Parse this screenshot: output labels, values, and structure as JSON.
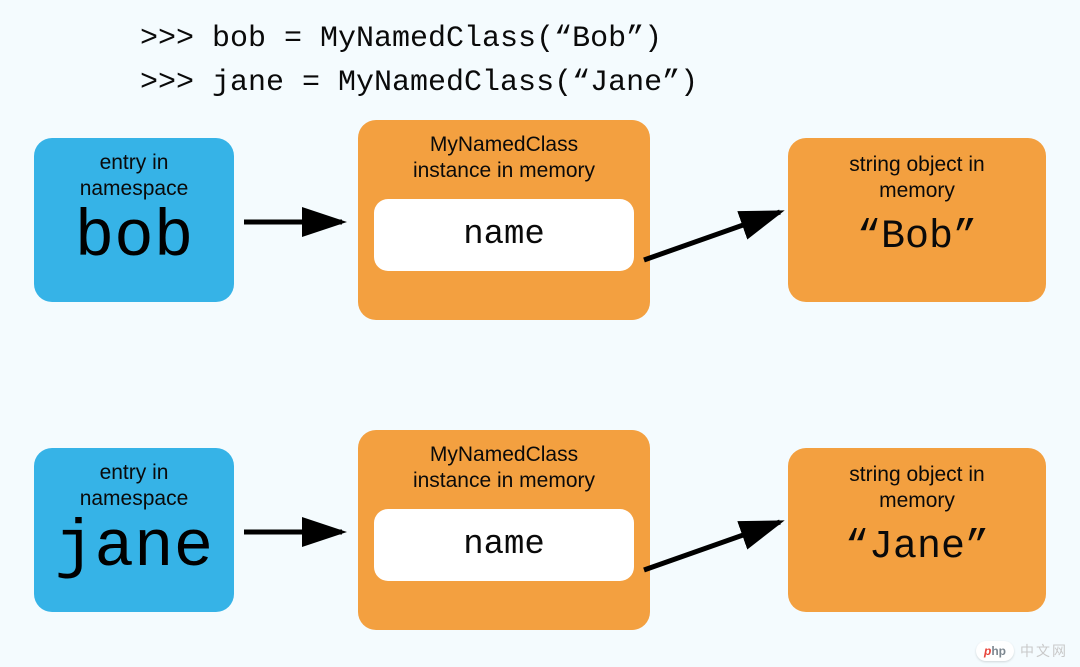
{
  "code": {
    "line1": ">>> bob = MyNamedClass(“Bob”)",
    "line2": ">>> jane = MyNamedClass(“Jane”)"
  },
  "labels": {
    "namespace": "entry in\nnamespace",
    "instance": "MyNamedClass\ninstance in memory",
    "string": "string object in\nmemory",
    "attr": "name"
  },
  "rows": [
    {
      "ns_name": "bob",
      "string_value": "“Bob”"
    },
    {
      "ns_name": "jane",
      "string_value": "“Jane”"
    }
  ],
  "watermark": {
    "brand_left": "p",
    "brand_right": "hp",
    "text": "中文网"
  },
  "chart_data": {
    "type": "table",
    "title": "Python object reference diagram",
    "columns": [
      "namespace_entry",
      "class",
      "attribute",
      "string_value"
    ],
    "rows": [
      [
        "bob",
        "MyNamedClass",
        "name",
        "Bob"
      ],
      [
        "jane",
        "MyNamedClass",
        "name",
        "Jane"
      ]
    ]
  }
}
